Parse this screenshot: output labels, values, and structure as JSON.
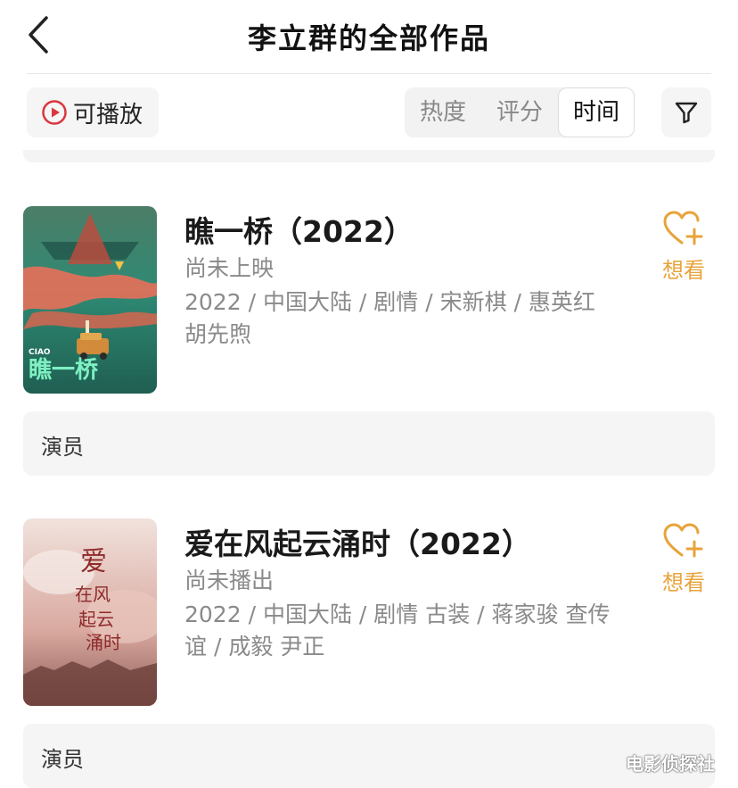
{
  "header": {
    "title": "李立群的全部作品",
    "back_icon": "chevron-left-icon"
  },
  "toolbar": {
    "playable_label": "可播放",
    "playable_icon": "play-circle-icon",
    "sort_tabs": [
      {
        "label": "热度",
        "active": false
      },
      {
        "label": "评分",
        "active": false
      },
      {
        "label": "时间",
        "active": true
      }
    ],
    "filter_icon": "filter-icon"
  },
  "movies": [
    {
      "title": "瞧一桥（2022）",
      "status": "尚未上映",
      "info": "2022 / 中国大陆 / 剧情 / 宋新棋 / 惠英红 胡先煦",
      "want_label": "想看",
      "poster_text": "瞧一桥",
      "poster_tag": "CIAO",
      "actor_label": "演员"
    },
    {
      "title": "爱在风起云涌时（2022）",
      "status": "尚未播出",
      "info": "2022 / 中国大陆 / 剧情 古装 / 蒋家骏 查传谊 / 成毅 尹正",
      "want_label": "想看",
      "poster_text": "爱在风起云涌时",
      "actor_label": "演员"
    }
  ],
  "watermark": "电影侦探社",
  "colors": {
    "accent": "#e8a33a",
    "play_red": "#d9363e"
  }
}
